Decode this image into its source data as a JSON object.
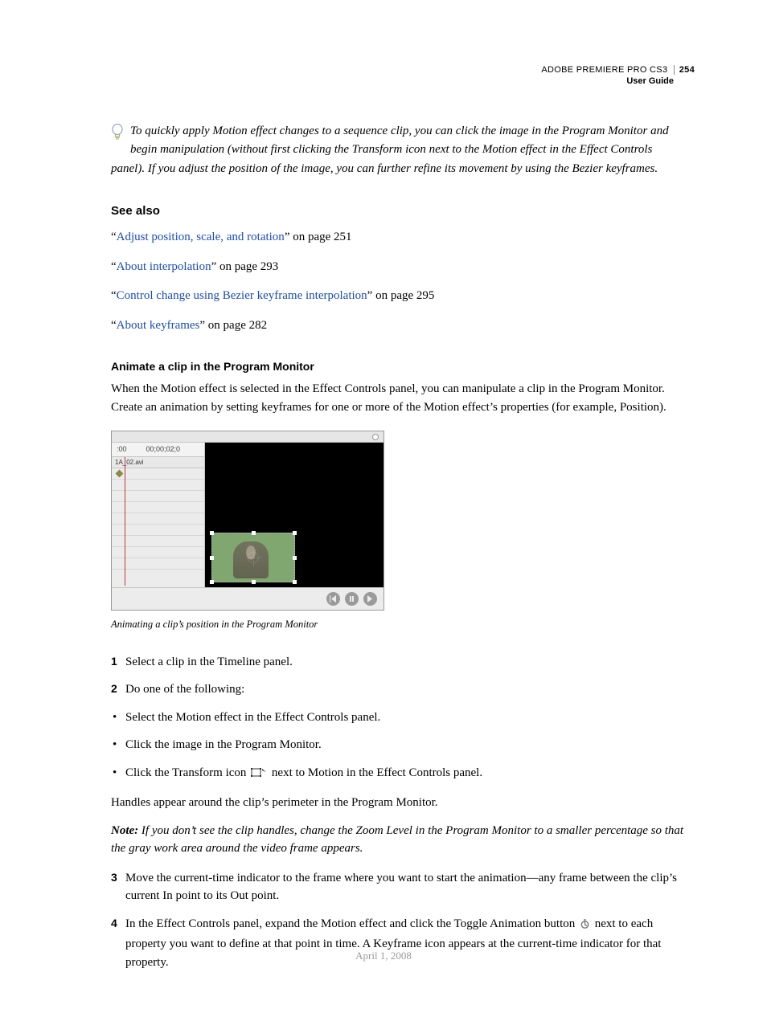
{
  "header": {
    "product": "ADOBE PREMIERE PRO CS3",
    "page_number": "254",
    "doc_title": "User Guide"
  },
  "tip": {
    "line1": "To quickly apply Motion effect changes to a sequence clip, you can click the image in the Program Monitor and begin manipulation (without first clicking the Transform icon next to the Motion effect in the Effect Controls",
    "line2": "panel). If you adjust the position of the image, you can further refine its movement by using the Bezier keyframes."
  },
  "see_also": {
    "heading": "See also",
    "items": [
      {
        "q1": "“",
        "link": "Adjust position, scale, and rotation",
        "tail": "” on page 251"
      },
      {
        "q1": "“",
        "link": "About interpolation",
        "tail": "” on page 293"
      },
      {
        "q1": "“",
        "link": "Control change using Bezier keyframe interpolation",
        "tail": "” on page 295"
      },
      {
        "q1": "“",
        "link": "About keyframes",
        "tail": "” on page 282"
      }
    ]
  },
  "section": {
    "heading": "Animate a clip in the Program Monitor",
    "intro": "When the Motion effect is selected in the Effect Controls panel, you can manipulate a clip in the Program Monitor. Create an animation by setting keyframes for one or more of the Motion effect’s properties (for example, Position)."
  },
  "figure": {
    "ruler_start": ":00",
    "ruler_time": "00;00;02;0",
    "track_label": "1A_02.avi",
    "caption": "Animating a clip’s position in the Program Monitor"
  },
  "steps": {
    "s1": "Select a clip in the Timeline panel.",
    "s2": "Do one of the following:",
    "b1": "Select the Motion effect in the Effect Controls panel.",
    "b2": "Click the image in the Program Monitor.",
    "b3_a": "Click the Transform icon ",
    "b3_b": " next to Motion in the Effect Controls panel.",
    "after_bullets": "Handles appear around the clip’s perimeter in the Program Monitor.",
    "note_label": "Note:",
    "note_body": " If you don’t see the clip handles, change the Zoom Level in the Program Monitor to a smaller percentage so that the gray work area around the video frame appears.",
    "s3": "Move the current-time indicator to the frame where you want to start the animation—any frame between the clip’s current In point to its Out point.",
    "s4_a": "In the Effect Controls panel, expand the Motion effect and click the Toggle Animation button ",
    "s4_b": " next to each property you want to define at that point in time. A Keyframe icon appears at the current-time indicator for that property."
  },
  "nums": {
    "n1": "1",
    "n2": "2",
    "n3": "3",
    "n4": "4"
  },
  "footer": {
    "date": "April 1, 2008"
  }
}
